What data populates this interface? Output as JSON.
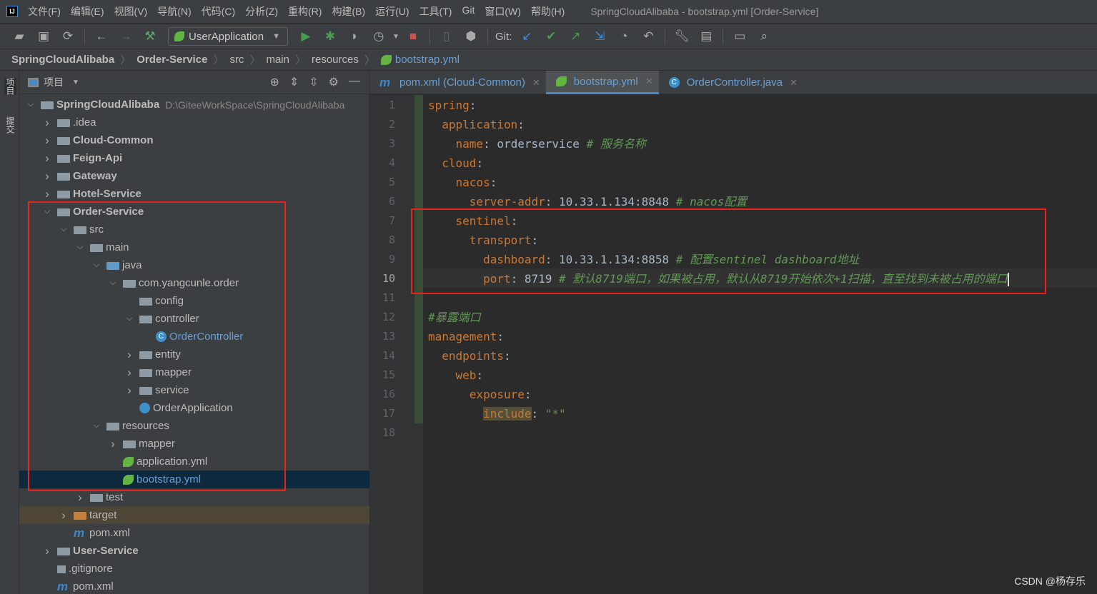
{
  "menu": {
    "items": [
      "文件(F)",
      "编辑(E)",
      "视图(V)",
      "导航(N)",
      "代码(C)",
      "分析(Z)",
      "重构(R)",
      "构建(B)",
      "运行(U)",
      "工具(T)",
      "Git",
      "窗口(W)",
      "帮助(H)"
    ],
    "window_title": "SpringCloudAlibaba - bootstrap.yml [Order-Service]"
  },
  "toolbar": {
    "run_config": "UserApplication",
    "git_label": "Git:"
  },
  "breadcrumb": [
    "SpringCloudAlibaba",
    "Order-Service",
    "src",
    "main",
    "resources",
    "bootstrap.yml"
  ],
  "left_strip": {
    "project": "项目",
    "commit": "提交"
  },
  "project_panel": {
    "title": "项目"
  },
  "tree": [
    {
      "d": 0,
      "a": "open",
      "i": "module",
      "t": "SpringCloudAlibaba",
      "b": true,
      "p": "D:\\GiteeWorkSpace\\SpringCloudAlibaba"
    },
    {
      "d": 1,
      "a": "closed",
      "i": "folder",
      "t": ".idea"
    },
    {
      "d": 1,
      "a": "closed",
      "i": "module",
      "t": "Cloud-Common",
      "b": true
    },
    {
      "d": 1,
      "a": "closed",
      "i": "module",
      "t": "Feign-Api",
      "b": true
    },
    {
      "d": 1,
      "a": "closed",
      "i": "module",
      "t": "Gateway",
      "b": true
    },
    {
      "d": 1,
      "a": "closed",
      "i": "module",
      "t": "Hotel-Service",
      "b": true
    },
    {
      "d": 1,
      "a": "open",
      "i": "module",
      "t": "Order-Service",
      "b": true
    },
    {
      "d": 2,
      "a": "open",
      "i": "folder",
      "t": "src"
    },
    {
      "d": 3,
      "a": "open",
      "i": "folder",
      "t": "main"
    },
    {
      "d": 4,
      "a": "open",
      "i": "folder-blue",
      "t": "java"
    },
    {
      "d": 5,
      "a": "open",
      "i": "package",
      "t": "com.yangcunle.order"
    },
    {
      "d": 6,
      "a": "none",
      "i": "package",
      "t": "config"
    },
    {
      "d": 6,
      "a": "open",
      "i": "package",
      "t": "controller"
    },
    {
      "d": 7,
      "a": "none",
      "i": "class",
      "t": "OrderController",
      "blue": true
    },
    {
      "d": 6,
      "a": "closed",
      "i": "package",
      "t": "entity"
    },
    {
      "d": 6,
      "a": "closed",
      "i": "package",
      "t": "mapper"
    },
    {
      "d": 6,
      "a": "closed",
      "i": "package",
      "t": "service"
    },
    {
      "d": 6,
      "a": "none",
      "i": "spring-class",
      "t": "OrderApplication"
    },
    {
      "d": 4,
      "a": "open",
      "i": "folder-res",
      "t": "resources"
    },
    {
      "d": 5,
      "a": "closed",
      "i": "folder",
      "t": "mapper"
    },
    {
      "d": 5,
      "a": "none",
      "i": "yml",
      "t": "application.yml"
    },
    {
      "d": 5,
      "a": "none",
      "i": "yml",
      "t": "bootstrap.yml",
      "sel": true,
      "blue": true
    },
    {
      "d": 3,
      "a": "closed",
      "i": "folder",
      "t": "test"
    },
    {
      "d": 2,
      "a": "closed",
      "i": "folder-orange",
      "t": "target",
      "tgt": true
    },
    {
      "d": 2,
      "a": "none",
      "i": "maven",
      "t": "pom.xml"
    },
    {
      "d": 1,
      "a": "closed",
      "i": "module",
      "t": "User-Service",
      "b": true
    },
    {
      "d": 1,
      "a": "none",
      "i": "gitignore",
      "t": ".gitignore"
    },
    {
      "d": 1,
      "a": "none",
      "i": "maven",
      "t": "pom.xml"
    }
  ],
  "tabs": [
    {
      "label": "pom.xml (Cloud-Common)",
      "icon": "maven"
    },
    {
      "label": "bootstrap.yml",
      "icon": "yml",
      "active": true
    },
    {
      "label": "OrderController.java",
      "icon": "class"
    }
  ],
  "code": [
    [
      [
        "k",
        "spring"
      ],
      [
        "v",
        ":"
      ]
    ],
    [
      [
        "v",
        "  "
      ],
      [
        "k",
        "application"
      ],
      [
        "v",
        ":"
      ]
    ],
    [
      [
        "v",
        "    "
      ],
      [
        "k",
        "name"
      ],
      [
        "v",
        ": orderservice "
      ],
      [
        "c",
        "# 服务名称"
      ]
    ],
    [
      [
        "v",
        "  "
      ],
      [
        "k",
        "cloud"
      ],
      [
        "v",
        ":"
      ]
    ],
    [
      [
        "v",
        "    "
      ],
      [
        "k",
        "nacos"
      ],
      [
        "v",
        ":"
      ]
    ],
    [
      [
        "v",
        "      "
      ],
      [
        "k",
        "server-addr"
      ],
      [
        "v",
        ": 10.33.1.134:8848 "
      ],
      [
        "c",
        "# nacos配置"
      ]
    ],
    [
      [
        "v",
        "    "
      ],
      [
        "k",
        "sentinel"
      ],
      [
        "v",
        ":"
      ]
    ],
    [
      [
        "v",
        "      "
      ],
      [
        "k",
        "transport"
      ],
      [
        "v",
        ":"
      ]
    ],
    [
      [
        "v",
        "        "
      ],
      [
        "k",
        "dashboard"
      ],
      [
        "v",
        ": 10.33.1.134:8858 "
      ],
      [
        "c",
        "# 配置sentinel dashboard地址"
      ]
    ],
    [
      [
        "v",
        "        "
      ],
      [
        "k",
        "port"
      ],
      [
        "v",
        ": 8719 "
      ],
      [
        "c",
        "# 默认8719端口，如果被占用，默认从8719开始依次+1扫描，直至找到未被占用的端口"
      ]
    ],
    [],
    [
      [
        "c",
        "#暴露端口"
      ]
    ],
    [
      [
        "k",
        "management"
      ],
      [
        "v",
        ":"
      ]
    ],
    [
      [
        "v",
        "  "
      ],
      [
        "k",
        "endpoints"
      ],
      [
        "v",
        ":"
      ]
    ],
    [
      [
        "v",
        "    "
      ],
      [
        "k",
        "web"
      ],
      [
        "v",
        ":"
      ]
    ],
    [
      [
        "v",
        "      "
      ],
      [
        "k",
        "exposure"
      ],
      [
        "v",
        ":"
      ]
    ],
    [
      [
        "v",
        "        "
      ],
      [
        "hl",
        "include"
      ],
      [
        "v",
        ": "
      ],
      [
        "s",
        "\"*\""
      ]
    ],
    []
  ],
  "current_line": 10,
  "watermark": "CSDN @杨存乐"
}
